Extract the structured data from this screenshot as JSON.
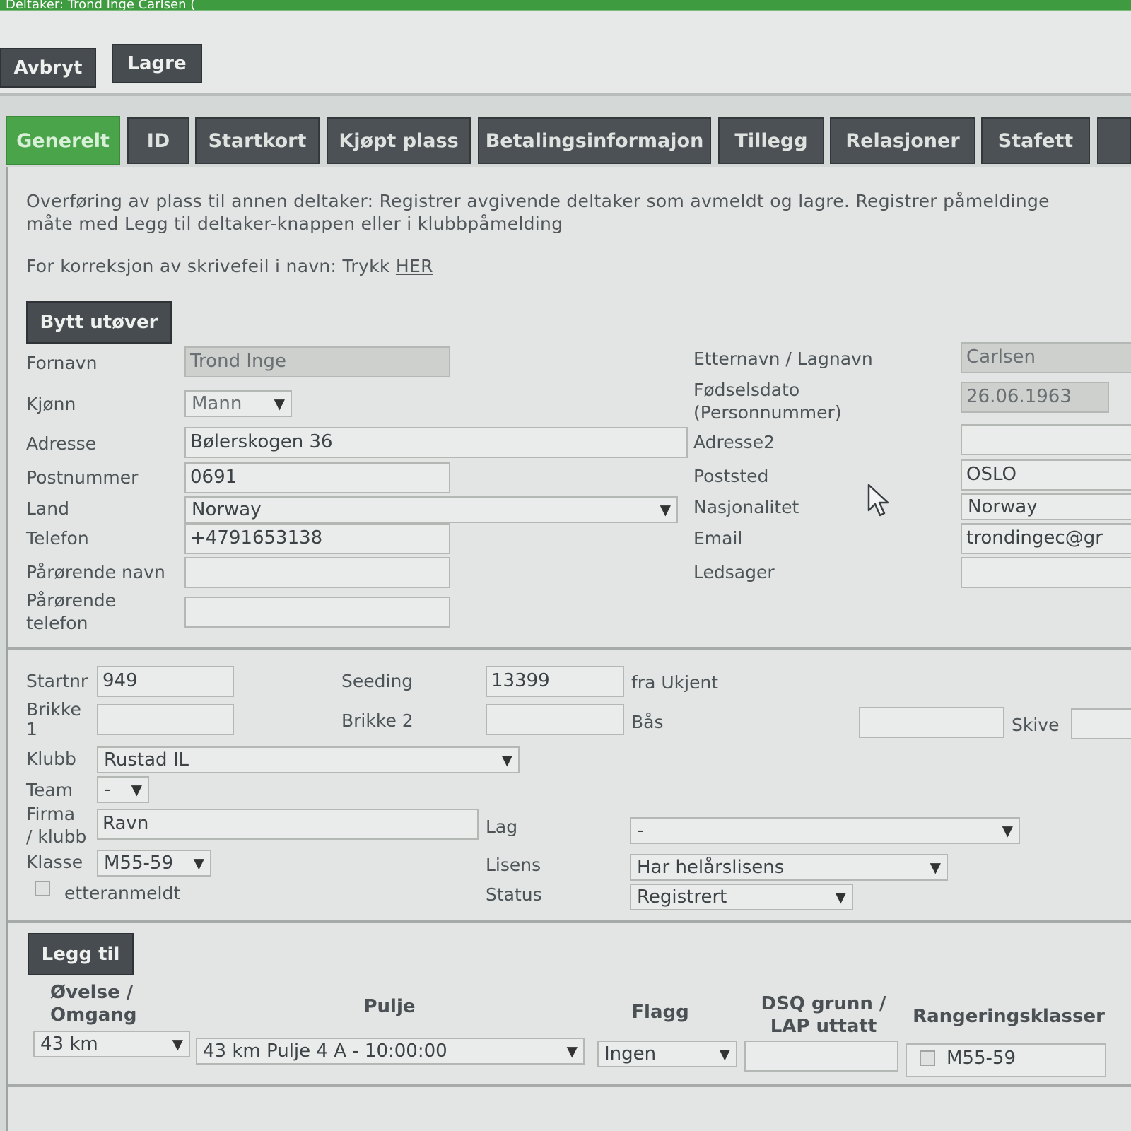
{
  "window": {
    "title": "Deltaker: Trond Inge Carlsen ("
  },
  "toolbar": {
    "cancel_label": "Avbryt",
    "save_label": "Lagre"
  },
  "tabs": [
    "Generelt",
    "ID",
    "Startkort",
    "Kjøpt plass",
    "Betalingsinformajon",
    "Tillegg",
    "Relasjoner",
    "Stafett"
  ],
  "active_tab": "Generelt",
  "info": {
    "line1": "Overføring av plass til annen deltaker: Registrer avgivende deltaker som avmeldt og lagre. Registrer påmeldinge",
    "line2": "måte med Legg til deltaker-knappen eller i klubbpåmelding",
    "correction_prefix": "For korreksjon av skrivefeil i navn: Trykk ",
    "correction_link": "HER"
  },
  "swap_button": "Bytt utøver",
  "person": {
    "fornavn_label": "Fornavn",
    "fornavn": "Trond Inge",
    "kjonn_label": "Kjønn",
    "kjonn": "Mann",
    "adresse_label": "Adresse",
    "adresse": "Bølerskogen 36",
    "postnummer_label": "Postnummer",
    "postnummer": "0691",
    "land_label": "Land",
    "land": "Norway",
    "telefon_label": "Telefon",
    "telefon": "+4791653138",
    "parorende_navn_label": "Pårørende navn",
    "parorende_navn": "",
    "parorende_tlf_label1": "Pårørende",
    "parorende_tlf_label2": "telefon",
    "parorende_tlf": "",
    "etternavn_label": "Etternavn / Lagnavn",
    "etternavn": "Carlsen",
    "fodselsdato_label1": "Fødselsdato",
    "fodselsdato_label2": "(Personnummer)",
    "fodselsdato": "26.06.1963",
    "adresse2_label": "Adresse2",
    "adresse2": "",
    "poststed_label": "Poststed",
    "poststed": "OSLO",
    "nasjonalitet_label": "Nasjonalitet",
    "nasjonalitet": "Norway",
    "email_label": "Email",
    "email": "trondingec@gr",
    "ledsager_label": "Ledsager",
    "ledsager": ""
  },
  "race": {
    "startnr_label": "Startnr",
    "startnr": "949",
    "seeding_label": "Seeding",
    "seeding": "13399",
    "seeding_from": "fra Ukjent",
    "brikke1_label1": "Brikke",
    "brikke1_label2": "1",
    "brikke1": "",
    "brikke2_label": "Brikke 2",
    "brikke2": "",
    "bas_label": "Bås",
    "bas": "",
    "skive_label": "Skive",
    "skive": "",
    "klubb_label": "Klubb",
    "klubb": "Rustad IL",
    "team_label": "Team",
    "team": "-",
    "firma_label1": "Firma",
    "firma_label2": "/ klubb",
    "firma": "Ravn",
    "lag_label": "Lag",
    "lag": "-",
    "klasse_label": "Klasse",
    "klasse": "M55-59",
    "lisens_label": "Lisens",
    "lisens": "Har helårslisens",
    "etteranmeldt_label": "etteranmeldt",
    "status_label": "Status",
    "status": "Registrert"
  },
  "add_button": "Legg til",
  "events_table": {
    "headers": {
      "ovelse1": "Øvelse /",
      "ovelse2": "Omgang",
      "pulje": "Pulje",
      "flagg": "Flagg",
      "dsq1": "DSQ grunn /",
      "dsq2": "LAP uttatt",
      "rangering": "Rangeringsklasser"
    },
    "row": {
      "ovelse": "43 km",
      "pulje": "43 km Pulje 4 A - 10:00:00",
      "flagg": "Ingen",
      "dsq": "",
      "rangering": "M55-59"
    }
  },
  "colors": {
    "tab_active": "#4aa44a",
    "tab": "#4b5155",
    "button": "#464c50"
  }
}
